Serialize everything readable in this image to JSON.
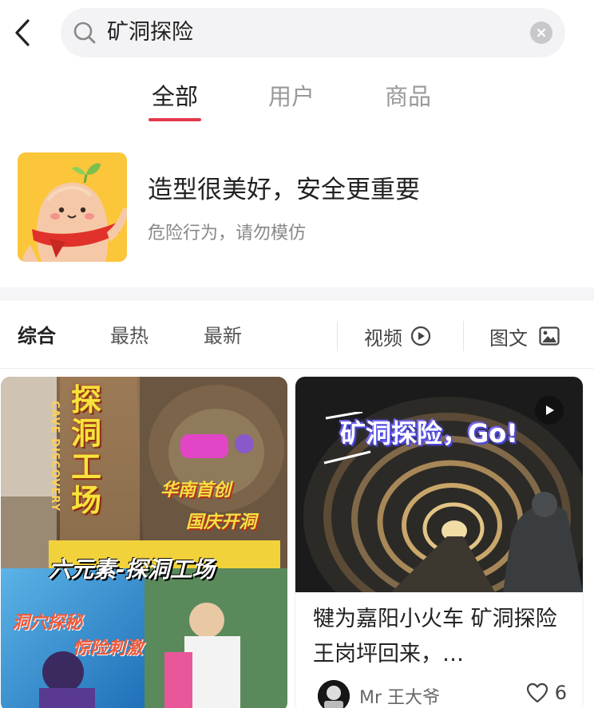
{
  "search": {
    "query": "矿洞探险"
  },
  "category_tabs": [
    {
      "label": "全部",
      "active": true
    },
    {
      "label": "用户",
      "active": false
    },
    {
      "label": "商品",
      "active": false
    }
  ],
  "notice": {
    "title": "造型很美好，安全更重要",
    "subtitle": "危险行为，请勿模仿"
  },
  "sort": {
    "options": [
      {
        "label": "综合",
        "active": true
      },
      {
        "label": "最热",
        "active": false
      },
      {
        "label": "最新",
        "active": false
      }
    ],
    "filters": [
      {
        "label": "视频",
        "icon": "play-circle-icon"
      },
      {
        "label": "图文",
        "icon": "image-icon"
      }
    ]
  },
  "cards": [
    {
      "image_text": {
        "sign_vertical": "探洞工场",
        "sign_english": "CAVE DISCOVERY",
        "line1": "华南首创",
        "line2": "国庆开洞",
        "banner": "六元素-探洞工场",
        "line3": "洞穴探秘",
        "line4": "惊险刺激"
      }
    },
    {
      "image_text": {
        "headline": "矿洞探险，Go!"
      },
      "title": "犍为嘉阳小火车 矿洞探险 王岗坪回来，…",
      "author": "Mr 王大爷",
      "likes": "6",
      "is_video": true
    }
  ],
  "colors": {
    "accent": "#e33a4b",
    "mascot_bg": "#fcc63a",
    "muted": "#999999"
  }
}
